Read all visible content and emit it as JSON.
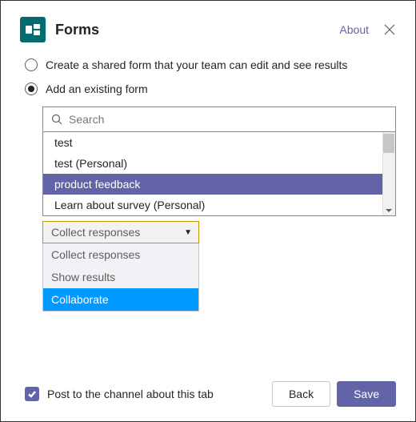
{
  "header": {
    "title": "Forms",
    "about_label": "About"
  },
  "options": {
    "create_label": "Create a shared form that your team can edit and see results",
    "add_label": "Add an existing form"
  },
  "search": {
    "placeholder": "Search",
    "value": ""
  },
  "forms": [
    {
      "label": "test",
      "selected": false
    },
    {
      "label": "test (Personal)",
      "selected": false
    },
    {
      "label": "product feedback",
      "selected": true
    },
    {
      "label": "Learn about survey (Personal)",
      "selected": false
    }
  ],
  "action_select": {
    "selected": "Collect responses",
    "options": [
      {
        "label": "Collect responses",
        "highlighted": false
      },
      {
        "label": "Show results",
        "highlighted": false
      },
      {
        "label": "Collaborate",
        "highlighted": true
      }
    ]
  },
  "footer": {
    "checkbox_label": "Post to the channel about this tab",
    "back_label": "Back",
    "save_label": "Save"
  },
  "colors": {
    "brand": "#6264a7",
    "forms_icon_bg": "#036c70",
    "highlight_blue": "#0099ff",
    "select_border": "#c19c00"
  }
}
